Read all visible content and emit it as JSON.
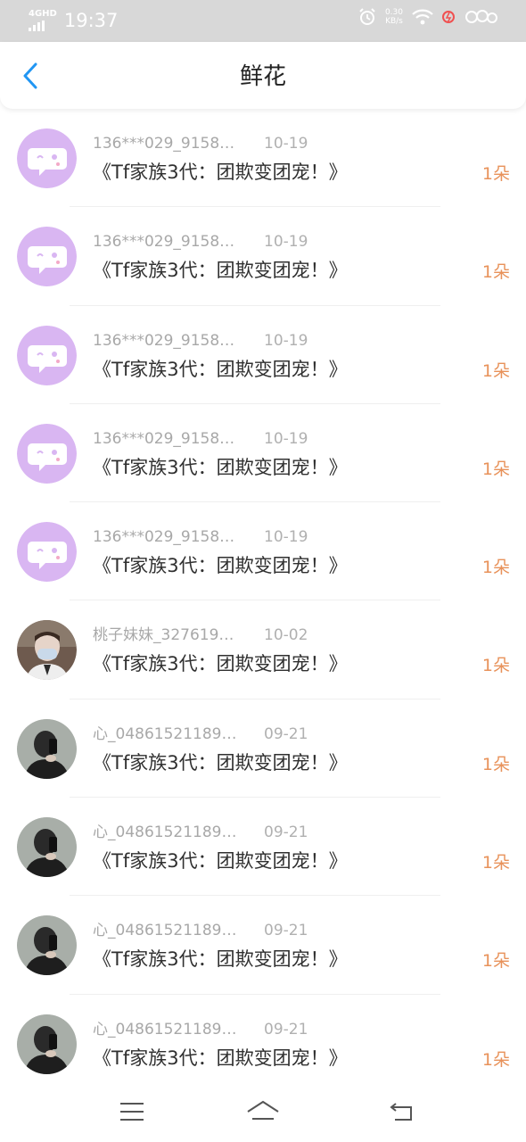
{
  "status_bar": {
    "network": "4GHD",
    "time": "19:37",
    "speed_value": "0.30",
    "speed_unit": "KB/s"
  },
  "header": {
    "title": "鲜花",
    "back_icon": "chevron-left-icon",
    "accent": "#2196f3"
  },
  "colors": {
    "count": "#e8925a",
    "avatar_bot_bg": "#d9b6f2"
  },
  "items": [
    {
      "name": "136***029_9158…",
      "date": "10-19",
      "book": "《Tf家族3代：团欺变团宠！》",
      "count": "1朵",
      "avatar": "chat-bubble-avatar"
    },
    {
      "name": "136***029_9158…",
      "date": "10-19",
      "book": "《Tf家族3代：团欺变团宠！》",
      "count": "1朵",
      "avatar": "chat-bubble-avatar"
    },
    {
      "name": "136***029_9158…",
      "date": "10-19",
      "book": "《Tf家族3代：团欺变团宠！》",
      "count": "1朵",
      "avatar": "chat-bubble-avatar"
    },
    {
      "name": "136***029_9158…",
      "date": "10-19",
      "book": "《Tf家族3代：团欺变团宠！》",
      "count": "1朵",
      "avatar": "chat-bubble-avatar"
    },
    {
      "name": "136***029_9158…",
      "date": "10-19",
      "book": "《Tf家族3代：团欺变团宠！》",
      "count": "1朵",
      "avatar": "chat-bubble-avatar"
    },
    {
      "name": "桃子妹妹_327619…",
      "date": "10-02",
      "book": "《Tf家族3代：团欺变团宠！》",
      "count": "1朵",
      "avatar": "masked-person-avatar"
    },
    {
      "name": "心_04861521189…",
      "date": "09-21",
      "book": "《Tf家族3代：团欺变团宠！》",
      "count": "1朵",
      "avatar": "mirror-selfie-avatar"
    },
    {
      "name": "心_04861521189…",
      "date": "09-21",
      "book": "《Tf家族3代：团欺变团宠！》",
      "count": "1朵",
      "avatar": "mirror-selfie-avatar"
    },
    {
      "name": "心_04861521189…",
      "date": "09-21",
      "book": "《Tf家族3代：团欺变团宠！》",
      "count": "1朵",
      "avatar": "mirror-selfie-avatar"
    },
    {
      "name": "心_04861521189…",
      "date": "09-21",
      "book": "《Tf家族3代：团欺变团宠！》",
      "count": "1朵",
      "avatar": "mirror-selfie-avatar"
    }
  ],
  "nav": {
    "menu_icon": "menu-icon",
    "home_icon": "home-icon",
    "back_icon": "return-icon"
  }
}
